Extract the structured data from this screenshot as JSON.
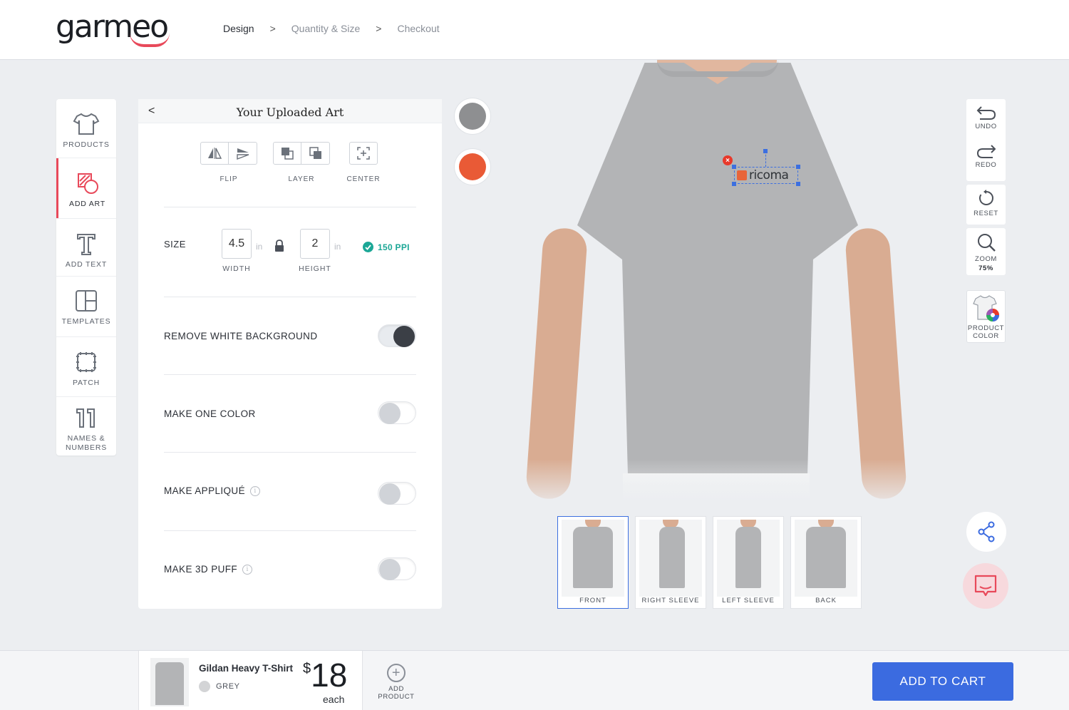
{
  "header": {
    "logo": "garmeo",
    "steps": [
      {
        "label": "Design",
        "active": true
      },
      {
        "label": "Quantity & Size",
        "active": false
      },
      {
        "label": "Checkout",
        "active": false
      }
    ],
    "separator": ">"
  },
  "leftbar": {
    "items": [
      {
        "label": "PRODUCTS",
        "icon": "tshirt-icon"
      },
      {
        "label": "ADD ART",
        "icon": "add-art-icon",
        "active": true
      },
      {
        "label": "ADD TEXT",
        "icon": "text-icon"
      },
      {
        "label": "TEMPLATES",
        "icon": "templates-icon"
      },
      {
        "label": "PATCH",
        "icon": "patch-icon"
      },
      {
        "label_line1": "NAMES &",
        "label_line2": "NUMBERS",
        "icon": "numbers-icon"
      }
    ]
  },
  "panel": {
    "back": "<",
    "title": "Your Uploaded Art",
    "flip_label": "FLIP",
    "layer_label": "LAYER",
    "center_label": "CENTER",
    "size_label": "SIZE",
    "width_value": "4.5",
    "height_value": "2",
    "unit": "in",
    "width_label": "WIDTH",
    "height_label": "HEIGHT",
    "ppi": "150 PPI",
    "options": [
      {
        "label": "REMOVE WHITE BACKGROUND",
        "on": true,
        "info": false
      },
      {
        "label": "MAKE ONE COLOR",
        "on": false,
        "info": false
      },
      {
        "label": "MAKE APPLIQUÉ",
        "on": false,
        "info": true
      },
      {
        "label": "MAKE 3D PUFF",
        "on": false,
        "info": true
      }
    ],
    "info_glyph": "i"
  },
  "ink_colors": [
    "#8e8f91",
    "#e95a36"
  ],
  "art": {
    "text": "ricoma",
    "delete": "×",
    "brand_color": "#e8653a"
  },
  "views": [
    {
      "label": "FRONT",
      "active": true
    },
    {
      "label": "RIGHT SLEEVE",
      "active": false
    },
    {
      "label": "LEFT SLEEVE",
      "active": false
    },
    {
      "label": "BACK",
      "active": false
    }
  ],
  "right_tools": {
    "undo": "UNDO",
    "redo": "REDO",
    "reset": "RESET",
    "zoom": "ZOOM",
    "zoom_value": "75%",
    "product_color_line1": "PRODUCT",
    "product_color_line2": "COLOR"
  },
  "footer": {
    "product_name": "Gildan Heavy T-Shirt",
    "color_name": "GREY",
    "currency": "$",
    "price": "18",
    "price_unit": "each",
    "add_product_line1": "ADD",
    "add_product_line2": "PRODUCT",
    "add_product_plus": "+",
    "cart": "ADD TO CART"
  },
  "colors": {
    "accent": "#3b6be0",
    "brand": "#e8495a",
    "success": "#1ba796"
  }
}
